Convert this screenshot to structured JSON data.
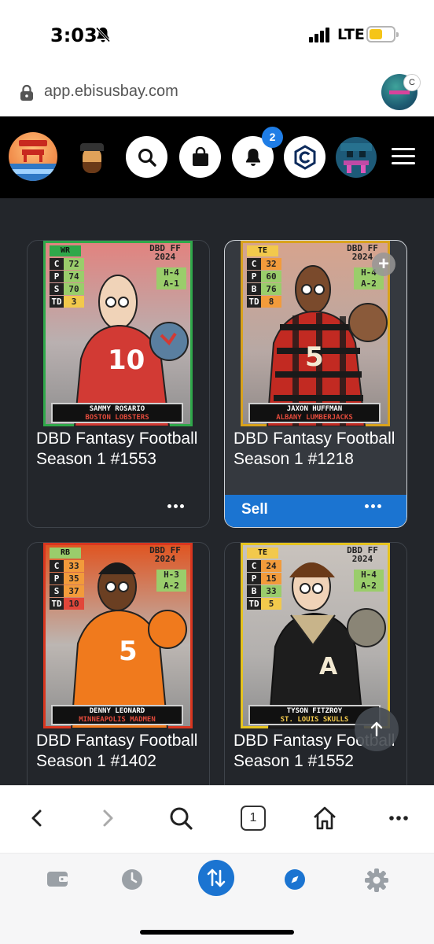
{
  "status_bar": {
    "time": "3:03",
    "network": "LTE",
    "battery_level": 0.55,
    "battery_color": "#f5c518"
  },
  "url_bar": {
    "url": "app.ebisusbay.com",
    "profile_badge": "C"
  },
  "app_nav": {
    "notification_count": "2",
    "icons": [
      "ebisus-bay-logo",
      "mascot-avatar",
      "search-icon",
      "shopping-bag-icon",
      "bell-icon",
      "cronos-icon",
      "user-avatar",
      "hamburger-menu-icon"
    ]
  },
  "cards": [
    {
      "title": "DBD Fantasy Football Season 1 #1553",
      "position": "WR",
      "stats": [
        [
          "C",
          "72"
        ],
        [
          "P",
          "74"
        ],
        [
          "S",
          "70"
        ],
        [
          "TD",
          "3"
        ]
      ],
      "brand": "DBD FF 2024",
      "home": "H-4",
      "away": "A-1",
      "player_name": "SAMMY ROSARIO",
      "team": "BOSTON LOBSTERS",
      "jersey": "10",
      "frame_color": "#2fa84a",
      "team_color": "#d23a34",
      "selected": false
    },
    {
      "title": "DBD Fantasy Football Season 1 #1218",
      "position": "TE",
      "stats": [
        [
          "C",
          "32"
        ],
        [
          "P",
          "60"
        ],
        [
          "B",
          "76"
        ],
        [
          "TD",
          "8"
        ]
      ],
      "brand": "DBD FF 2024",
      "home": "H-4",
      "away": "A-2",
      "player_name": "JAXON HUFFMAN",
      "team": "ALBANY LUMBERJACKS",
      "jersey": "5",
      "frame_color": "#d8a21c",
      "team_color": "#b3201d",
      "selected": true,
      "action_label": "Sell"
    },
    {
      "title": "DBD Fantasy Football Season 1 #1402",
      "position": "RB",
      "stats": [
        [
          "C",
          "33"
        ],
        [
          "P",
          "35"
        ],
        [
          "S",
          "37"
        ],
        [
          "TD",
          "10"
        ]
      ],
      "brand": "DBD FF 2024",
      "home": "H-3",
      "away": "A-2",
      "player_name": "DENNY LEONARD",
      "team": "MINNEAPOLIS MADMEN",
      "jersey": "5",
      "frame_color": "#d9361f",
      "team_color": "#f07a1d",
      "selected": false
    },
    {
      "title": "DBD Fantasy Football Season 1 #1552",
      "position": "TE",
      "stats": [
        [
          "C",
          "24"
        ],
        [
          "P",
          "15"
        ],
        [
          "B",
          "33"
        ],
        [
          "TD",
          "5"
        ]
      ],
      "brand": "DBD FF 2024",
      "home": "H-4",
      "away": "A-2",
      "player_name": "TYSON FITZROY",
      "team": "ST. LOUIS SKULLS",
      "jersey": "A",
      "frame_color": "#e5c31f",
      "team_color": "#1d1d1d",
      "selected": false
    }
  ],
  "browser_toolbar": {
    "tab_count": "1",
    "icons": [
      "back-icon",
      "forward-icon",
      "search-icon",
      "tabs-icon",
      "home-icon",
      "more-icon"
    ]
  },
  "bottom_nav": {
    "icons": [
      "wallet-icon",
      "history-icon",
      "swap-icon",
      "explore-icon",
      "settings-icon"
    ],
    "active": "swap-icon",
    "accent": "#1b74d1"
  }
}
